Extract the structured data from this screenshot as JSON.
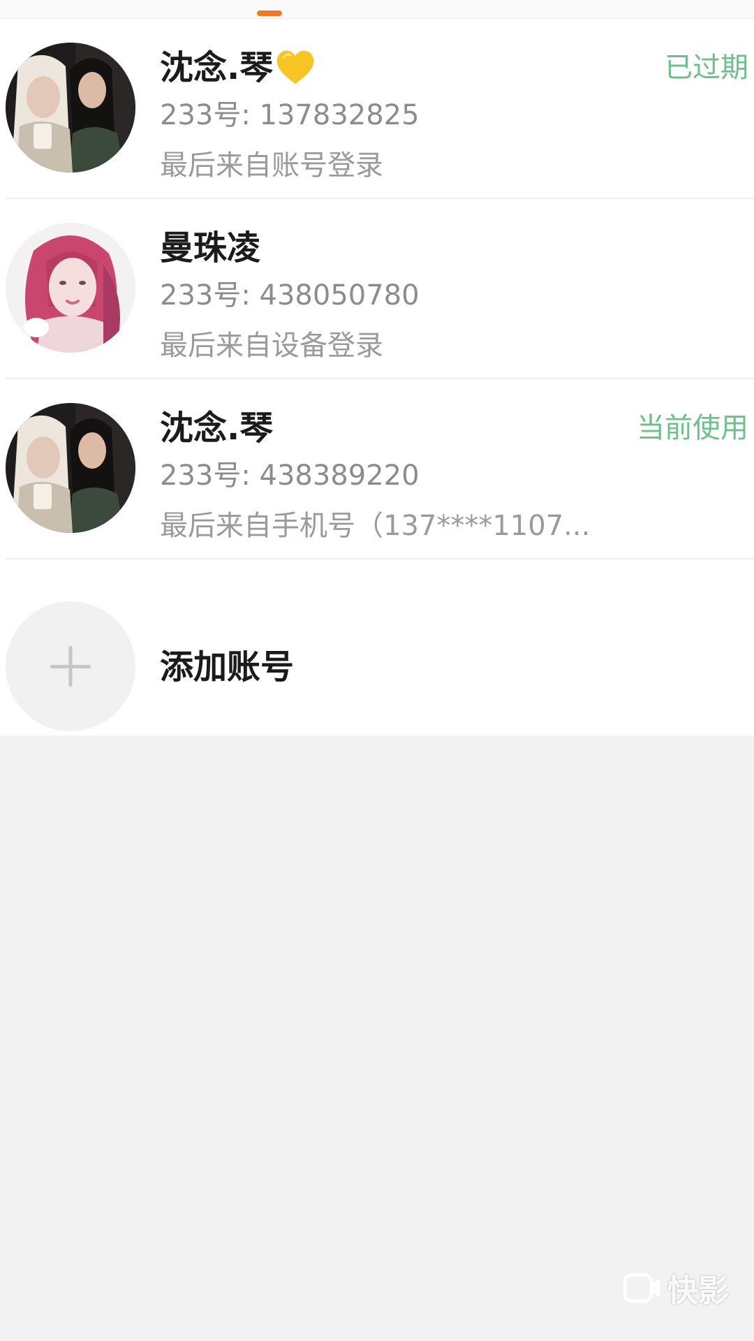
{
  "accounts": [
    {
      "name": "沈念.琴",
      "name_emoji": "yellow-heart-icon",
      "uid": "233号: 137832825",
      "last_login": "最后来自账号登录",
      "status": "已过期",
      "avatar": "photo-two-girls"
    },
    {
      "name": "曼珠凌",
      "uid": "233号: 438050780",
      "last_login": "最后来自设备登录",
      "status": "",
      "avatar": "illustration-pink-hair-girl"
    },
    {
      "name": "沈念.琴",
      "uid": "233号: 438389220",
      "last_login": "最后来自手机号（137****1107...",
      "status": "当前使用",
      "avatar": "photo-two-girls"
    }
  ],
  "add_account": {
    "label": "添加账号",
    "icon": "plus-icon"
  },
  "watermark": {
    "text": "快影",
    "icon": "kuaiying-logo-icon"
  },
  "colors": {
    "status_green": "#6fbf8a",
    "tab_indicator": "#f07a25",
    "primary_text": "#1b1b1b",
    "secondary_text": "#8c8c8c",
    "page_background": "#f2f2f2"
  }
}
